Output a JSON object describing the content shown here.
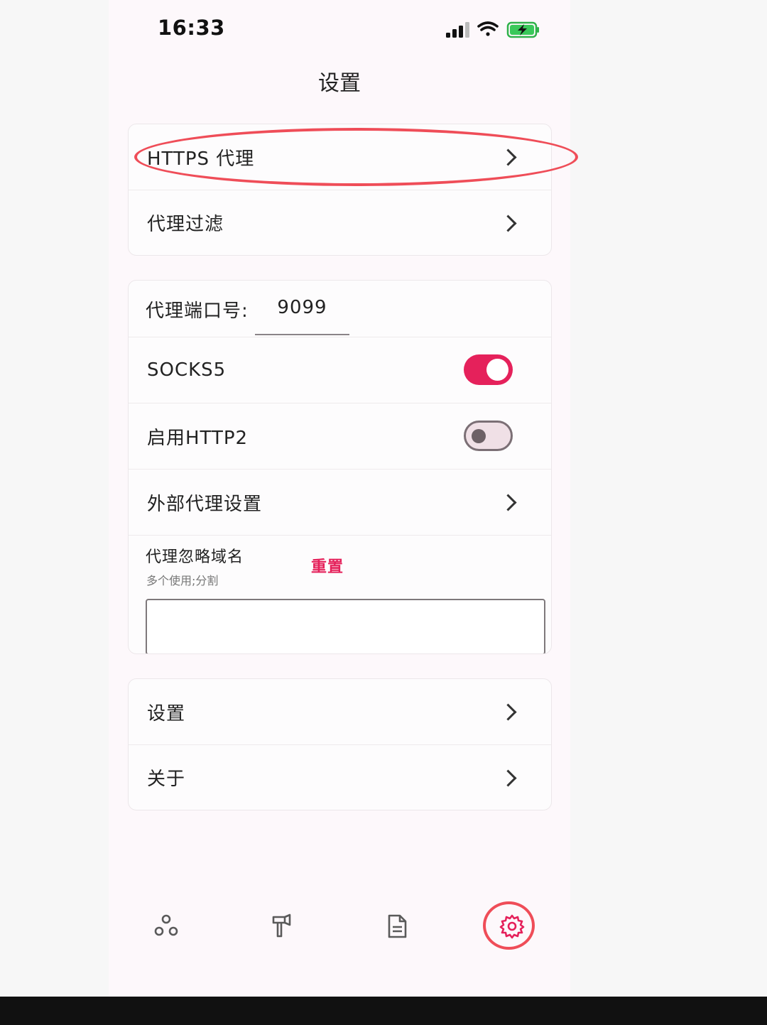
{
  "status_bar": {
    "time": "16:33",
    "icons": [
      "signal-icon",
      "wifi-icon",
      "battery-charging-icon"
    ]
  },
  "page": {
    "title": "设置"
  },
  "proxy_card": {
    "items": [
      {
        "label": "HTTPS 代理",
        "icon": "chevron-right-icon"
      },
      {
        "label": "代理过滤",
        "icon": "chevron-right-icon"
      }
    ]
  },
  "network_card": {
    "port_label": "代理端口号:",
    "port_value": "9099",
    "socks5": {
      "label": "SOCKS5",
      "enabled": true
    },
    "http2": {
      "label": "启用HTTP2",
      "enabled": false
    },
    "external_proxy": {
      "label": "外部代理设置",
      "icon": "chevron-right-icon"
    },
    "ignore_domains": {
      "title": "代理忽略域名",
      "hint": "多个使用;分割",
      "reset_label": "重置",
      "value": ""
    }
  },
  "misc_card": {
    "items": [
      {
        "label": "设置",
        "icon": "chevron-right-icon"
      },
      {
        "label": "关于",
        "icon": "chevron-right-icon"
      }
    ]
  },
  "bottom_nav": {
    "items": [
      {
        "icon": "nodes-icon",
        "active": false
      },
      {
        "icon": "hammer-icon",
        "active": false
      },
      {
        "icon": "document-icon",
        "active": false
      },
      {
        "icon": "gear-icon",
        "active": true
      }
    ]
  },
  "colors": {
    "accent": "#e5215b",
    "annotation": "#ef4d58",
    "background": "#fdf8fb"
  }
}
